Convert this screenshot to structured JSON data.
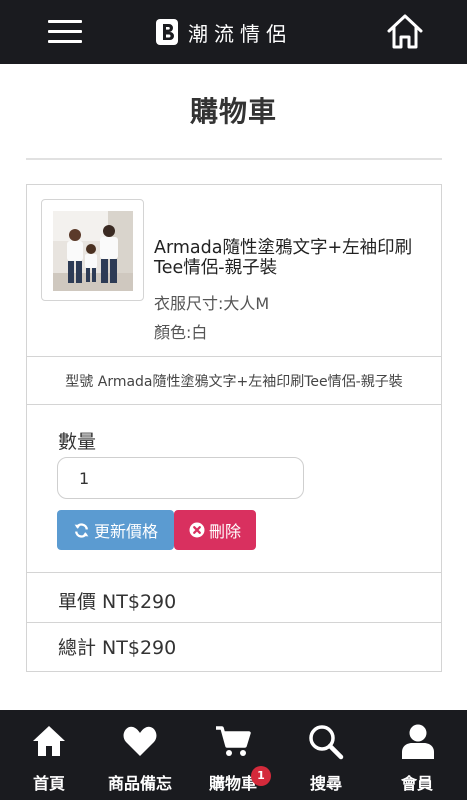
{
  "header": {
    "brand": "潮流情侶",
    "menu_icon": "menu-icon",
    "home_icon": "home-icon"
  },
  "page": {
    "title": "購物車"
  },
  "cart": {
    "item": {
      "name": "Armada隨性塗鴉文字+左袖印刷Tee情侶-親子裝",
      "size": "衣服尺寸:大人M",
      "color": "顏色:白",
      "model": "型號 Armada隨性塗鴉文字+左袖印刷Tee情侶-親子裝"
    },
    "quantity": {
      "label": "數量",
      "value": "1"
    },
    "update_button": "更新價格",
    "delete_button": "刪除",
    "unit_price": "單價 NT$290",
    "total": "總計 NT$290"
  },
  "bottom_nav": {
    "items": [
      {
        "label": "首頁",
        "icon": "home-icon"
      },
      {
        "label": "商品備忘",
        "icon": "heart-icon"
      },
      {
        "label": "購物車",
        "icon": "cart-icon",
        "badge": "1"
      },
      {
        "label": "搜尋",
        "icon": "search-icon"
      },
      {
        "label": "會員",
        "icon": "user-icon"
      }
    ]
  },
  "colors": {
    "bar": "#1a1b1f",
    "update": "#5b9bd1",
    "delete": "#d9305f",
    "badge": "#d42a3b"
  }
}
